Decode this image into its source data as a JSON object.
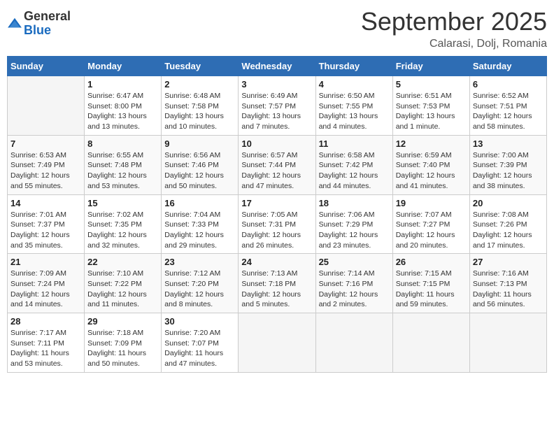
{
  "header": {
    "logo_general": "General",
    "logo_blue": "Blue",
    "month_title": "September 2025",
    "location": "Calarasi, Dolj, Romania"
  },
  "calendar": {
    "days_of_week": [
      "Sunday",
      "Monday",
      "Tuesday",
      "Wednesday",
      "Thursday",
      "Friday",
      "Saturday"
    ],
    "weeks": [
      [
        {
          "day": "",
          "info": ""
        },
        {
          "day": "1",
          "info": "Sunrise: 6:47 AM\nSunset: 8:00 PM\nDaylight: 13 hours and 13 minutes."
        },
        {
          "day": "2",
          "info": "Sunrise: 6:48 AM\nSunset: 7:58 PM\nDaylight: 13 hours and 10 minutes."
        },
        {
          "day": "3",
          "info": "Sunrise: 6:49 AM\nSunset: 7:57 PM\nDaylight: 13 hours and 7 minutes."
        },
        {
          "day": "4",
          "info": "Sunrise: 6:50 AM\nSunset: 7:55 PM\nDaylight: 13 hours and 4 minutes."
        },
        {
          "day": "5",
          "info": "Sunrise: 6:51 AM\nSunset: 7:53 PM\nDaylight: 13 hours and 1 minute."
        },
        {
          "day": "6",
          "info": "Sunrise: 6:52 AM\nSunset: 7:51 PM\nDaylight: 12 hours and 58 minutes."
        }
      ],
      [
        {
          "day": "7",
          "info": "Sunrise: 6:53 AM\nSunset: 7:49 PM\nDaylight: 12 hours and 55 minutes."
        },
        {
          "day": "8",
          "info": "Sunrise: 6:55 AM\nSunset: 7:48 PM\nDaylight: 12 hours and 53 minutes."
        },
        {
          "day": "9",
          "info": "Sunrise: 6:56 AM\nSunset: 7:46 PM\nDaylight: 12 hours and 50 minutes."
        },
        {
          "day": "10",
          "info": "Sunrise: 6:57 AM\nSunset: 7:44 PM\nDaylight: 12 hours and 47 minutes."
        },
        {
          "day": "11",
          "info": "Sunrise: 6:58 AM\nSunset: 7:42 PM\nDaylight: 12 hours and 44 minutes."
        },
        {
          "day": "12",
          "info": "Sunrise: 6:59 AM\nSunset: 7:40 PM\nDaylight: 12 hours and 41 minutes."
        },
        {
          "day": "13",
          "info": "Sunrise: 7:00 AM\nSunset: 7:39 PM\nDaylight: 12 hours and 38 minutes."
        }
      ],
      [
        {
          "day": "14",
          "info": "Sunrise: 7:01 AM\nSunset: 7:37 PM\nDaylight: 12 hours and 35 minutes."
        },
        {
          "day": "15",
          "info": "Sunrise: 7:02 AM\nSunset: 7:35 PM\nDaylight: 12 hours and 32 minutes."
        },
        {
          "day": "16",
          "info": "Sunrise: 7:04 AM\nSunset: 7:33 PM\nDaylight: 12 hours and 29 minutes."
        },
        {
          "day": "17",
          "info": "Sunrise: 7:05 AM\nSunset: 7:31 PM\nDaylight: 12 hours and 26 minutes."
        },
        {
          "day": "18",
          "info": "Sunrise: 7:06 AM\nSunset: 7:29 PM\nDaylight: 12 hours and 23 minutes."
        },
        {
          "day": "19",
          "info": "Sunrise: 7:07 AM\nSunset: 7:27 PM\nDaylight: 12 hours and 20 minutes."
        },
        {
          "day": "20",
          "info": "Sunrise: 7:08 AM\nSunset: 7:26 PM\nDaylight: 12 hours and 17 minutes."
        }
      ],
      [
        {
          "day": "21",
          "info": "Sunrise: 7:09 AM\nSunset: 7:24 PM\nDaylight: 12 hours and 14 minutes."
        },
        {
          "day": "22",
          "info": "Sunrise: 7:10 AM\nSunset: 7:22 PM\nDaylight: 12 hours and 11 minutes."
        },
        {
          "day": "23",
          "info": "Sunrise: 7:12 AM\nSunset: 7:20 PM\nDaylight: 12 hours and 8 minutes."
        },
        {
          "day": "24",
          "info": "Sunrise: 7:13 AM\nSunset: 7:18 PM\nDaylight: 12 hours and 5 minutes."
        },
        {
          "day": "25",
          "info": "Sunrise: 7:14 AM\nSunset: 7:16 PM\nDaylight: 12 hours and 2 minutes."
        },
        {
          "day": "26",
          "info": "Sunrise: 7:15 AM\nSunset: 7:15 PM\nDaylight: 11 hours and 59 minutes."
        },
        {
          "day": "27",
          "info": "Sunrise: 7:16 AM\nSunset: 7:13 PM\nDaylight: 11 hours and 56 minutes."
        }
      ],
      [
        {
          "day": "28",
          "info": "Sunrise: 7:17 AM\nSunset: 7:11 PM\nDaylight: 11 hours and 53 minutes."
        },
        {
          "day": "29",
          "info": "Sunrise: 7:18 AM\nSunset: 7:09 PM\nDaylight: 11 hours and 50 minutes."
        },
        {
          "day": "30",
          "info": "Sunrise: 7:20 AM\nSunset: 7:07 PM\nDaylight: 11 hours and 47 minutes."
        },
        {
          "day": "",
          "info": ""
        },
        {
          "day": "",
          "info": ""
        },
        {
          "day": "",
          "info": ""
        },
        {
          "day": "",
          "info": ""
        }
      ]
    ]
  }
}
